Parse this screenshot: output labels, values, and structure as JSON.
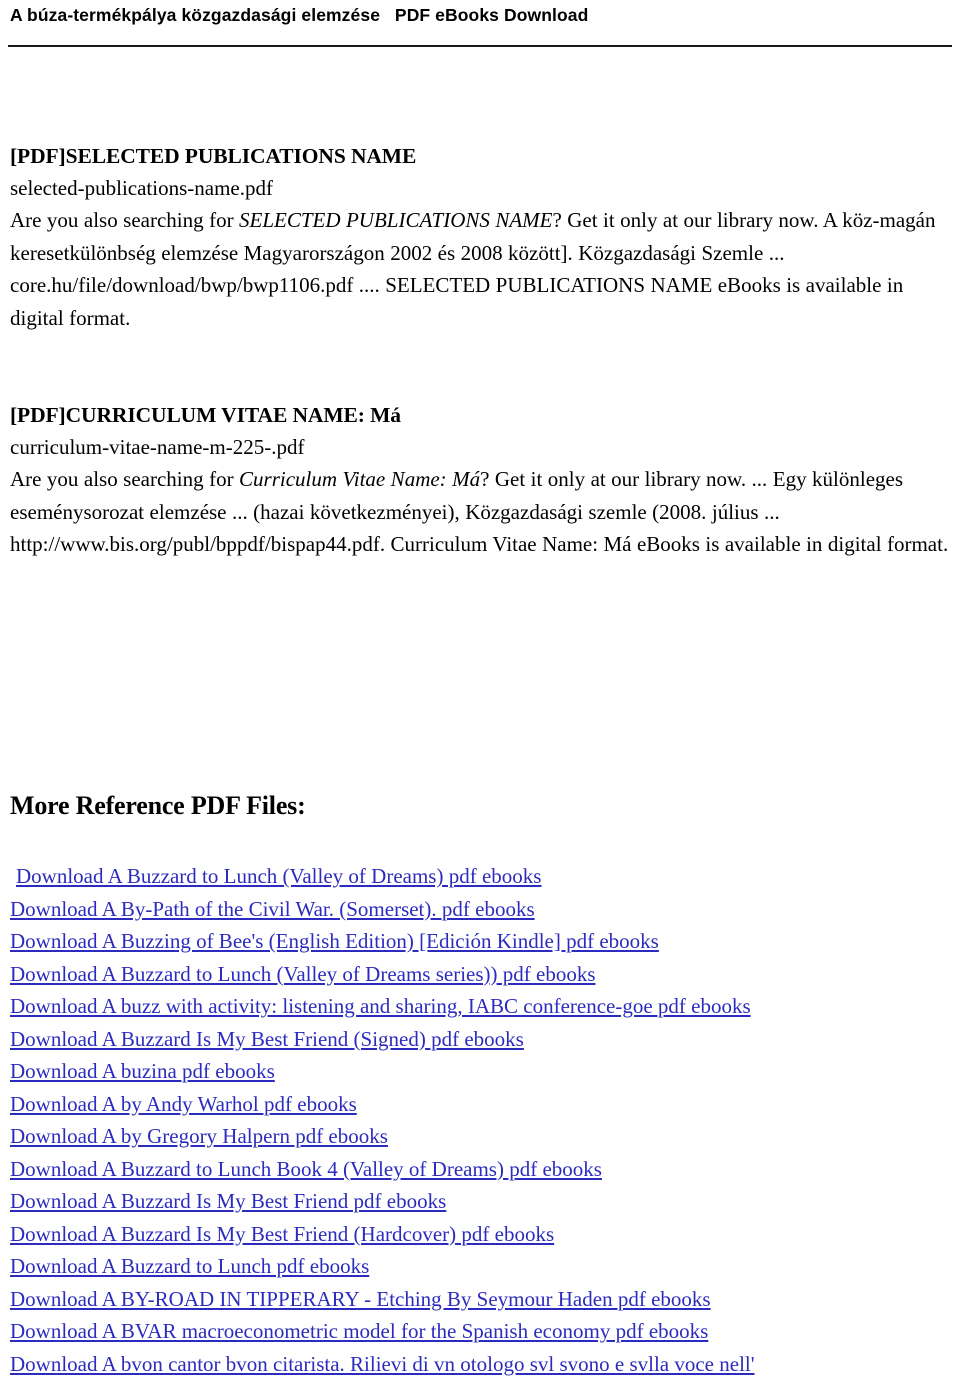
{
  "header": {
    "title": "A búza-termékpálya közgazdasági elemzése   PDF eBooks Download"
  },
  "entries": [
    {
      "title": "[PDF]SELECTED PUBLICATIONS NAME",
      "filename": "selected-publications-name.pdf",
      "body_pre_italic": "Are you also searching for ",
      "body_italic": "SELECTED PUBLICATIONS NAME",
      "body_post_italic": "? Get it only at our library now. A köz-magán keresetkülönbség elemzése Magyarországon 2002 és 2008 között]. Közgazdasági Szemle ... core.hu/file/download/bwp/bwp1106.pdf .... SELECTED PUBLICATIONS NAME eBooks is available in digital format."
    },
    {
      "title": "[PDF]CURRICULUM VITAE NAME: Má",
      "filename": "curriculum-vitae-name-m-225-.pdf",
      "body_pre_italic": "Are you also searching for ",
      "body_italic": "Curriculum Vitae Name: Má",
      "body_post_italic": "? Get it only at our library now. ... Egy különleges eseménysorozat elemzése ... (hazai következményei), Közgazdasági szemle (2008. július ... http://www.bis.org/publ/bppdf/bispap44.pdf. Curriculum Vitae Name: Má eBooks is available in digital format."
    }
  ],
  "more_reference": {
    "heading": "More Reference PDF Files:",
    "links": [
      "Download A Buzzard to Lunch (Valley of Dreams) pdf ebooks",
      "Download A By-Path of the Civil War. (Somerset). pdf ebooks",
      "Download A Buzzing of Bee's (English Edition) [Edición Kindle] pdf ebooks",
      "Download A Buzzard to Lunch (Valley of Dreams series)) pdf ebooks",
      "Download A buzz with activity: listening and sharing, IABC conference-goe pdf ebooks",
      "Download A Buzzard Is My Best Friend (Signed) pdf ebooks",
      "Download A buzina pdf ebooks",
      "Download A by Andy Warhol pdf ebooks",
      "Download A by Gregory Halpern pdf ebooks",
      "Download A Buzzard to Lunch Book 4 (Valley of Dreams) pdf ebooks",
      "Download A Buzzard Is My Best Friend pdf ebooks",
      "Download A Buzzard Is My Best Friend (Hardcover) pdf ebooks",
      "Download A Buzzard to Lunch pdf ebooks",
      "Download A BY-ROAD IN TIPPERARY - Etching By Seymour Haden pdf ebooks",
      "Download A BVAR macroeconometric model for the Spanish economy pdf ebooks",
      "Download A bvon cantor bvon citarista. Rilievi di vn otologo svl svono e svlla voce nell'"
    ]
  },
  "colors": {
    "link": "#2b2bbf",
    "text": "#000000",
    "rule": "#1a1a1a",
    "background": "#ffffff"
  }
}
